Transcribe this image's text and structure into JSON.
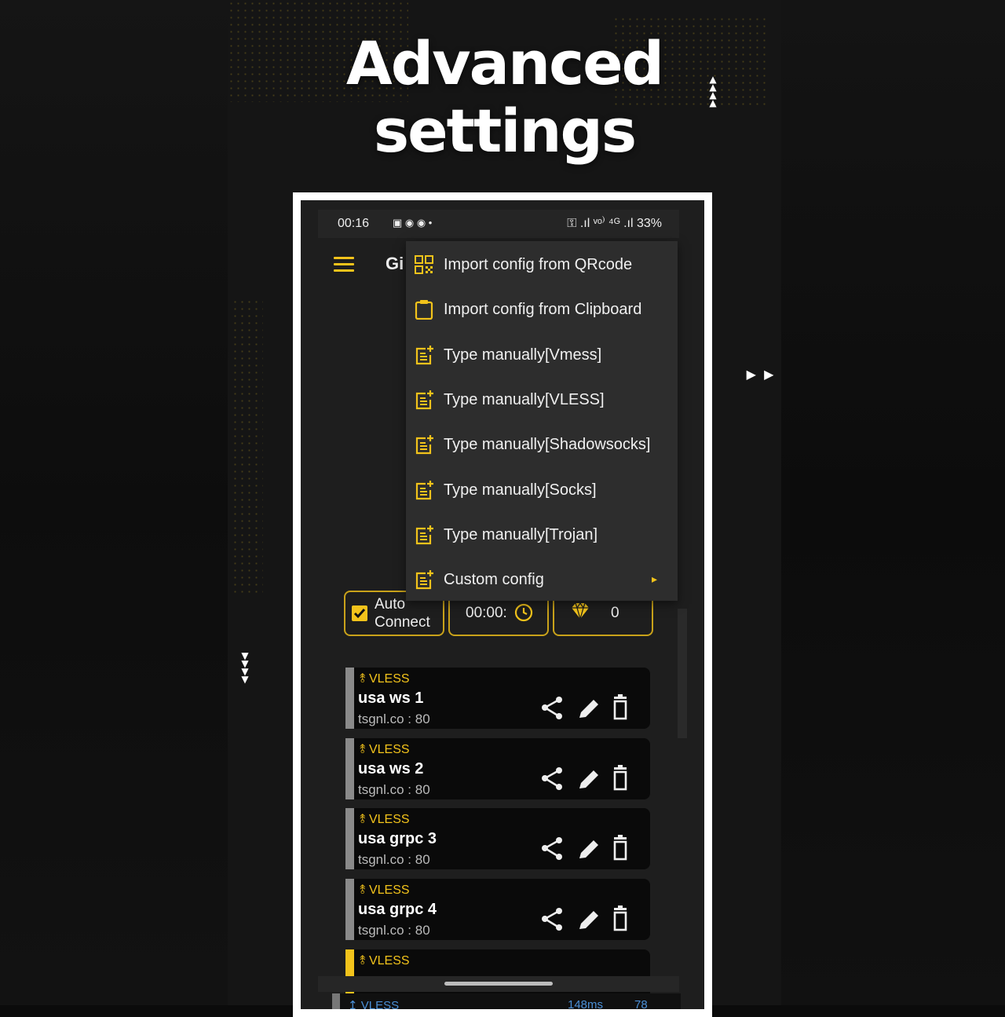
{
  "headline": {
    "line1": "Advanced",
    "line2": "settings"
  },
  "statusbar": {
    "time": "00:16",
    "icons": "▣ ◉ ◉ •",
    "right": "⚿ .ıl ᵛᵒ⁾ ⁴ᴳ .ıl 33%"
  },
  "appbar": {
    "title": "Gi"
  },
  "menu": [
    {
      "label": "Import config from QRcode",
      "icon": "qr-icon"
    },
    {
      "label": "Import config from Clipboard",
      "icon": "clipboard-icon"
    },
    {
      "label": "Type manually[Vmess]",
      "icon": "note-add-icon"
    },
    {
      "label": "Type manually[VLESS]",
      "icon": "note-add-icon"
    },
    {
      "label": "Type manually[Shadowsocks]",
      "icon": "note-add-icon"
    },
    {
      "label": "Type manually[Socks]",
      "icon": "note-add-icon"
    },
    {
      "label": "Type manually[Trojan]",
      "icon": "note-add-icon"
    },
    {
      "label": "Custom config",
      "icon": "note-add-icon",
      "submenu_chevron": "▸"
    }
  ],
  "stats": {
    "auto_connect_line1": "Auto",
    "auto_connect_line2": "Connect",
    "auto_connect_checked": true,
    "timer": "00:00:",
    "points": "0"
  },
  "servers": [
    {
      "protocol": "VLESS",
      "name": "usa ws 1",
      "address": "tsgnl.co : 80"
    },
    {
      "protocol": "VLESS",
      "name": "usa ws 2",
      "address": "tsgnl.co : 80"
    },
    {
      "protocol": "VLESS",
      "name": "usa grpc 3",
      "address": "tsgnl.co : 80"
    },
    {
      "protocol": "VLESS",
      "name": "usa grpc 4",
      "address": "tsgnl.co : 80"
    },
    {
      "protocol": "VLESS",
      "name": "",
      "address": ""
    }
  ],
  "bottom_row": {
    "protocol": "↥ VLESS",
    "latency": "148ms",
    "count": "78"
  },
  "colors": {
    "accent": "#f2c31b",
    "menu_bg": "#2d2d2d",
    "card_bg": "#0a0a0a",
    "selected_bar": "#f2c31b",
    "bar": "#8a8a8a"
  }
}
